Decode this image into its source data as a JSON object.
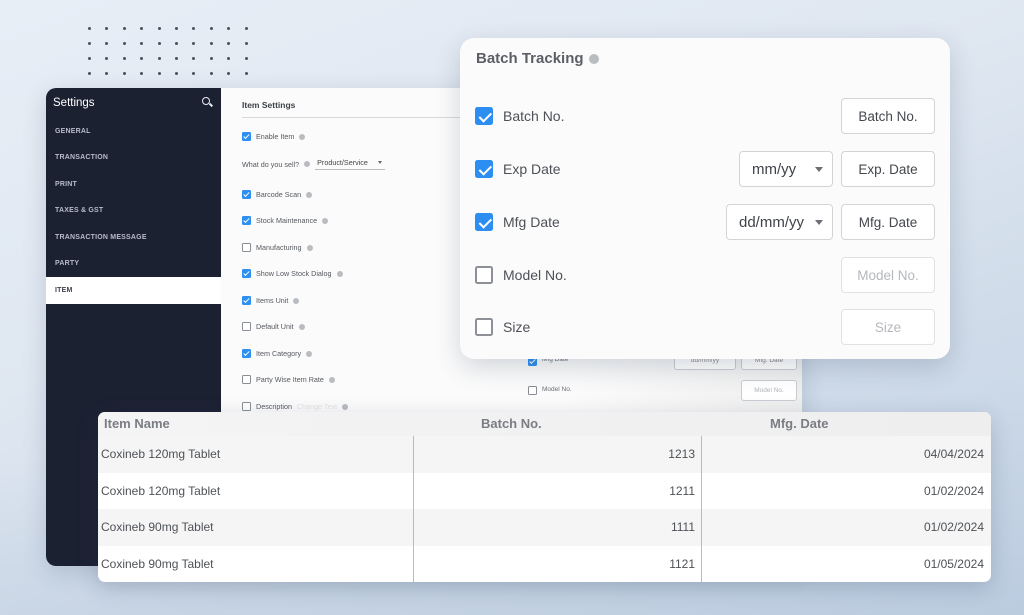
{
  "settings": {
    "title": "Settings",
    "search_icon": "search-icon",
    "sidebar_items": [
      {
        "label": "GENERAL",
        "active": false
      },
      {
        "label": "TRANSACTION",
        "active": false
      },
      {
        "label": "PRINT",
        "active": false
      },
      {
        "label": "TAXES & GST",
        "active": false
      },
      {
        "label": "TRANSACTION MESSAGE",
        "active": false
      },
      {
        "label": "PARTY",
        "active": false
      },
      {
        "label": "ITEM",
        "active": true
      }
    ],
    "item_settings": {
      "heading": "Item Settings",
      "enable_item": {
        "label": "Enable Item",
        "checked": true
      },
      "what_sell": {
        "label": "What do you sell?",
        "value": "Product/Service"
      },
      "options": [
        {
          "label": "Barcode Scan",
          "checked": true
        },
        {
          "label": "Stock Maintenance",
          "checked": true
        },
        {
          "label": "Manufacturing",
          "checked": false
        },
        {
          "label": "Show Low Stock Dialog",
          "checked": true
        },
        {
          "label": "Items Unit",
          "checked": true
        },
        {
          "label": "Default Unit",
          "checked": false
        },
        {
          "label": "Item Category",
          "checked": true
        },
        {
          "label": "Party Wise Item Rate",
          "checked": false
        },
        {
          "label": "Description",
          "checked": false
        }
      ],
      "description_extra": "Change Text"
    },
    "ghost_rows": {
      "mfg_label": "Mfg Date",
      "mfg_format": "dd/mm/yy",
      "mfg_input": "Mfg. Date",
      "model_label": "Model No.",
      "model_input": "Model No."
    }
  },
  "batch_tracking": {
    "title": "Batch Tracking",
    "rows": [
      {
        "label": "Batch No.",
        "checked": true,
        "format": null,
        "input_placeholder": "Batch No."
      },
      {
        "label": "Exp Date",
        "checked": true,
        "format": "mm/yy",
        "input_placeholder": "Exp. Date"
      },
      {
        "label": "Mfg Date",
        "checked": true,
        "format": "dd/mm/yy",
        "input_placeholder": "Mfg. Date"
      },
      {
        "label": "Model No.",
        "checked": false,
        "format": null,
        "input_placeholder": "Model No."
      },
      {
        "label": "Size",
        "checked": false,
        "format": null,
        "input_placeholder": "Size"
      }
    ],
    "accent_color": "#2c8ef1"
  },
  "batch_table": {
    "columns": [
      "Item Name",
      "Batch No.",
      "Mfg. Date"
    ],
    "rows": [
      {
        "item_name": "Coxineb 120mg Tablet",
        "batch_no": "1213",
        "mfg_date": "04/04/2024"
      },
      {
        "item_name": "Coxineb 120mg Tablet",
        "batch_no": "1211",
        "mfg_date": "01/02/2024"
      },
      {
        "item_name": "Coxineb 90mg Tablet",
        "batch_no": "1111",
        "mfg_date": "01/02/2024"
      },
      {
        "item_name": "Coxineb 90mg Tablet",
        "batch_no": "1121",
        "mfg_date": "01/05/2024"
      }
    ]
  }
}
